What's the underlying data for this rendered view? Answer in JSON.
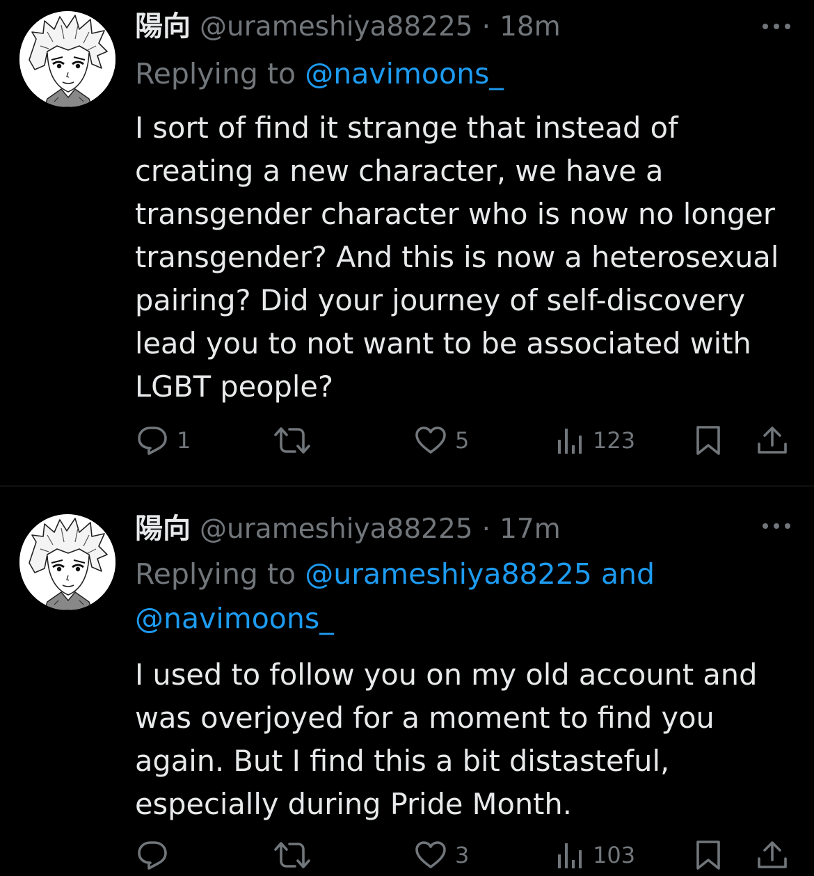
{
  "colors": {
    "background": "#000000",
    "text_primary": "#e7e9ea",
    "text_secondary": "#71767b",
    "link": "#1d9bf0",
    "divider": "#2f3336"
  },
  "tweets": [
    {
      "display_name": "陽向",
      "handle": "@urameshiya88225",
      "separator": "·",
      "time": "18m",
      "replying_prefix": "Replying to",
      "reply_mentions": [
        "@navimoons_"
      ],
      "reply_joiner": "",
      "text": "I sort of find it strange that instead of creating a new character, we have a transgender character who is now no longer transgender? And this is now a heterosexual pairing? Did your journey of self-discovery lead you to not want to be associated with LGBT people?",
      "stats": {
        "replies": "1",
        "retweets": "",
        "likes": "5",
        "views": "123"
      },
      "icons": [
        "more-icon",
        "reply-icon",
        "retweet-icon",
        "like-icon",
        "views-icon",
        "bookmark-icon",
        "share-icon"
      ]
    },
    {
      "display_name": "陽向",
      "handle": "@urameshiya88225",
      "separator": "·",
      "time": "17m",
      "replying_prefix": "Replying to",
      "reply_mentions": [
        "@urameshiya88225",
        "@navimoons_"
      ],
      "reply_joiner": "and",
      "text": "I used to follow you on my old account and was overjoyed for a moment to find you again. But I find this a bit distasteful, especially during Pride Month.",
      "stats": {
        "replies": "",
        "retweets": "",
        "likes": "3",
        "views": "103"
      },
      "icons": [
        "more-icon",
        "reply-icon",
        "retweet-icon",
        "like-icon",
        "views-icon",
        "bookmark-icon",
        "share-icon"
      ]
    }
  ]
}
